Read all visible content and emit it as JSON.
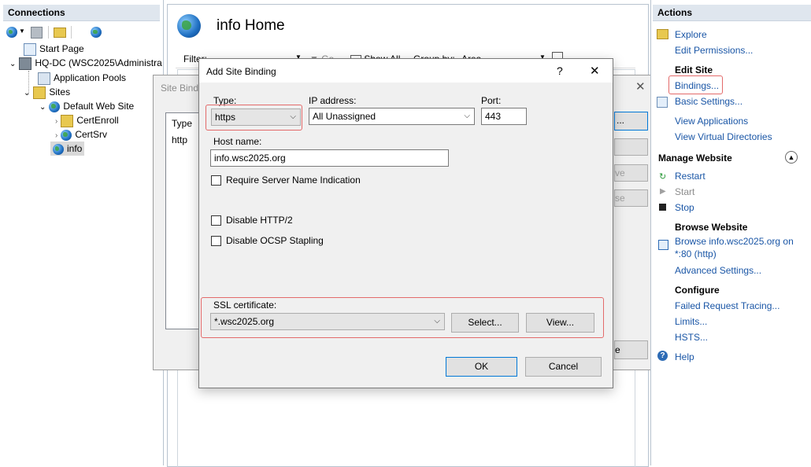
{
  "connections": {
    "title": "Connections",
    "tree": [
      {
        "label": "Start Page"
      },
      {
        "label": "HQ-DC (WSC2025\\Administra"
      },
      {
        "label": "Application Pools"
      },
      {
        "label": "Sites"
      },
      {
        "label": "Default Web Site"
      },
      {
        "label": "CertEnroll"
      },
      {
        "label": "CertSrv"
      },
      {
        "label": "info"
      }
    ]
  },
  "main": {
    "title": "info Home",
    "filter_label": "Filter:",
    "go_label": "Go",
    "show_all_label": "Show All",
    "group_by_label": "Group by:",
    "group_by_value": "Area"
  },
  "site_bindings": {
    "title": "Site Bindi",
    "col_type": "Type",
    "row_type": "http",
    "btn_partial_1": "...",
    "btn_partial_3": "ve",
    "btn_partial_4": "se",
    "btn_partial_close": "e"
  },
  "dialog": {
    "title": "Add Site Binding",
    "help": "?",
    "close": "✕",
    "type_label": "Type:",
    "type_value": "https",
    "ip_label": "IP address:",
    "ip_value": "All Unassigned",
    "port_label": "Port:",
    "port_value": "443",
    "host_label": "Host name:",
    "host_value": "info.wsc2025.org",
    "sni_label": "Require Server Name Indication",
    "http2_label": "Disable HTTP/2",
    "ocsp_label": "Disable OCSP Stapling",
    "ssl_label": "SSL certificate:",
    "ssl_value": "*.wsc2025.org",
    "select_label": "Select...",
    "view_label": "View...",
    "ok_label": "OK",
    "cancel_label": "Cancel"
  },
  "actions": {
    "title": "Actions",
    "explore": "Explore",
    "edit_permissions": "Edit Permissions...",
    "edit_site_header": "Edit Site",
    "bindings": "Bindings...",
    "basic_settings": "Basic Settings...",
    "view_applications": "View Applications",
    "view_virtual_dirs": "View Virtual Directories",
    "manage_header": "Manage Website",
    "restart": "Restart",
    "start": "Start",
    "stop": "Stop",
    "browse_header": "Browse Website",
    "browse_link_1": "Browse info.wsc2025.org on",
    "browse_link_2": "*:80 (http)",
    "advanced_settings": "Advanced Settings...",
    "configure_header": "Configure",
    "failed_request": "Failed Request Tracing...",
    "limits": "Limits...",
    "hsts": "HSTS...",
    "help": "Help"
  },
  "colors": {
    "highlight_outline": "#e36a6a",
    "link": "#1a56a6",
    "pane_header": "#dfe6ee"
  }
}
